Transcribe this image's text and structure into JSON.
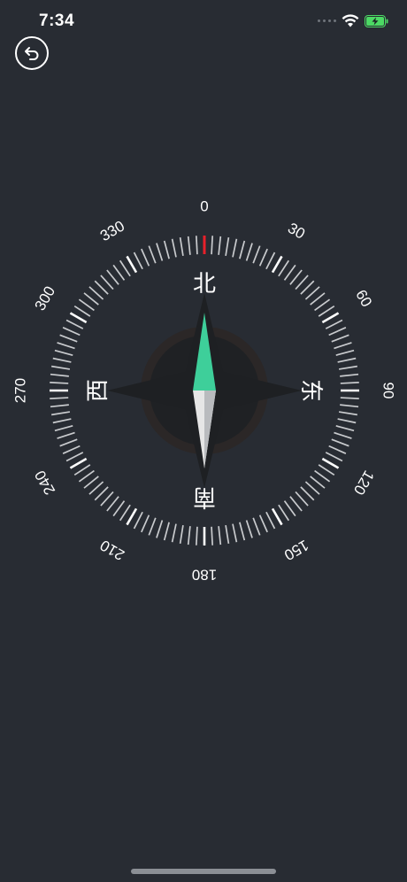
{
  "status_bar": {
    "time": "7:34"
  },
  "header": {
    "back_icon": "return-arrow-icon"
  },
  "compass": {
    "heading_degrees": 0,
    "degree_labels": [
      "0",
      "30",
      "60",
      "90",
      "120",
      "150",
      "180",
      "210",
      "240",
      "270",
      "300",
      "330"
    ],
    "cardinals": {
      "north": "北",
      "east": "东",
      "south": "南",
      "west": "西"
    },
    "colors": {
      "background": "#282c33",
      "needle_north": "#3ecf9a",
      "needle_south": "#e6e6e6",
      "heading_marker": "#e8202a",
      "tick": "#c9cbce"
    }
  }
}
